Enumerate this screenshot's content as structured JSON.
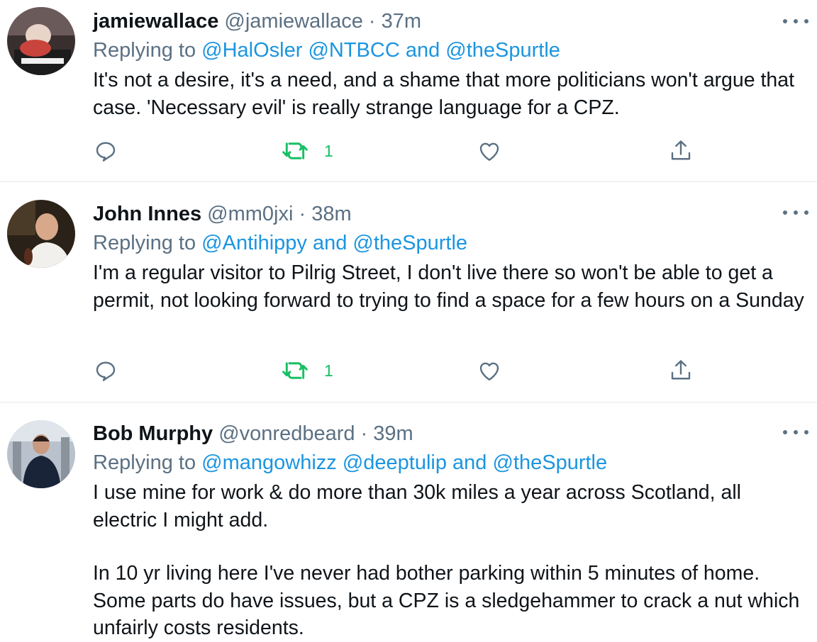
{
  "tweets": [
    {
      "name": "jamiewallace",
      "handle": "@jamiewallace",
      "separator": "·",
      "time": "37m",
      "replying_prefix": "Replying to",
      "mentions_text": "@HalOsler @NTBCC and @theSpurtle",
      "body": [
        "It's not a desire, it's a need, and a shame that more politicians won't argue that case. 'Necessary evil' is really strange language for a CPZ."
      ],
      "retweets": "1"
    },
    {
      "name": "John Innes",
      "handle": "@mm0jxi",
      "separator": "·",
      "time": "38m",
      "replying_prefix": "Replying to",
      "mentions_text": "@Antihippy and @theSpurtle",
      "body": [
        "I'm a regular visitor to Pilrig Street, I don't live there so won't be able to get a permit, not looking forward to trying to find a space for a few hours on a Sunday"
      ],
      "retweets": "1"
    },
    {
      "name": "Bob Murphy",
      "handle": "@vonredbeard",
      "separator": "·",
      "time": "39m",
      "replying_prefix": "Replying to",
      "mentions_text": "@mangowhizz @deeptulip and @theSpurtle",
      "body": [
        "I use mine for work & do more than 30k miles a year across Scotland, all electric I might add.",
        "In 10 yr living here I've never had bother parking within 5 minutes of home. Some parts do have issues, but a CPZ is a sledgehammer to crack a nut which unfairly costs residents."
      ]
    }
  ],
  "colors": {
    "text": "#0f1419",
    "secondary": "#5b7083",
    "link": "#1b95e0",
    "retweet_green": "#17bf63",
    "divider": "#e1e8ed"
  },
  "icons": [
    "reply-icon",
    "retweet-icon",
    "like-icon",
    "share-icon",
    "more-icon"
  ]
}
